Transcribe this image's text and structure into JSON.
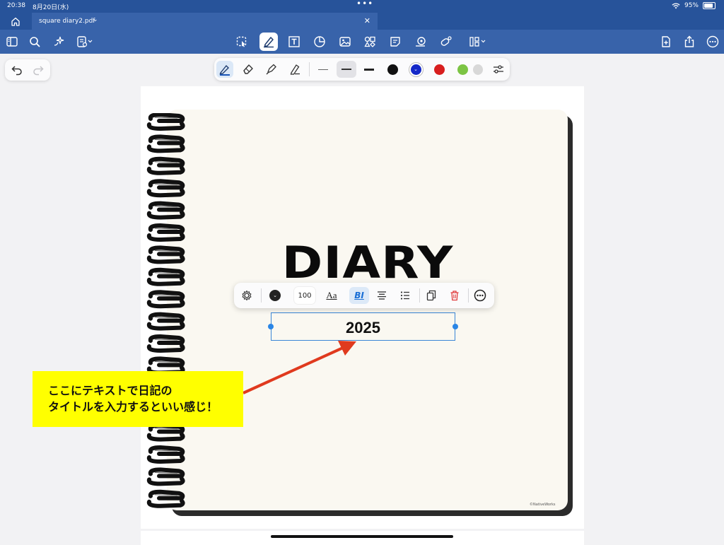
{
  "status_bar": {
    "time": "20:38",
    "date": "8月20日(水)",
    "battery": "95%"
  },
  "tab": {
    "file_name": "square diary2.pdf",
    "chevron": "⌄",
    "close": "✕"
  },
  "toolbar": {
    "icons": [
      "sidebar-icon",
      "search-icon",
      "ai-sparkle-icon",
      "annotation-list-icon",
      "lasso-select-icon",
      "pen-tool-icon",
      "text-box-icon",
      "shape-icon",
      "image-icon",
      "stamp-icon",
      "sticky-note-icon",
      "measure-icon",
      "signature-icon",
      "form-icon",
      "add-page-icon",
      "share-icon",
      "more-icon"
    ],
    "active": "pen-tool-icon"
  },
  "pen_tray": {
    "tools": [
      "fountain-pen-icon",
      "eraser-icon",
      "highlighter-icon",
      "pencil-icon"
    ],
    "selected_tool": "fountain-pen-icon",
    "thickness_options": [
      "thin",
      "medium",
      "thick"
    ],
    "selected_thickness": "medium",
    "colors": [
      "#111111",
      "#1428c8",
      "#d81e1e",
      "#7cc444",
      "#d8d8d8"
    ],
    "selected_color": "#1428c8"
  },
  "document": {
    "title": "DIARY",
    "watermark": "©NativeWorks",
    "text_box_value": "2025"
  },
  "text_menu": {
    "color": "#222222",
    "font_size": "100",
    "font_label": "Aa",
    "style_label": "BI",
    "selected": "style-button"
  },
  "callout": {
    "line1": "ここにテキストで日記の",
    "line2": "タイトルを入力するといい感じ！",
    "background": "#ffff00",
    "arrow_color": "#e03a1e"
  }
}
